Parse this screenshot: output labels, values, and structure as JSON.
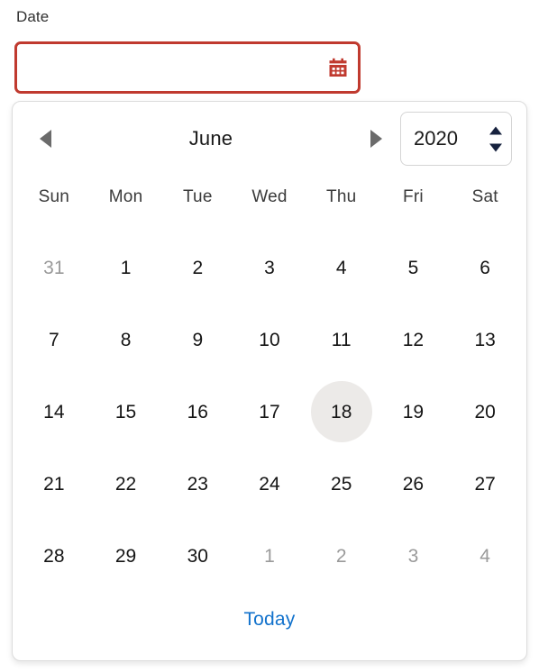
{
  "field": {
    "label": "Date",
    "value": "",
    "placeholder": "",
    "icon": "calendar-icon",
    "border_color": "#c03a2f"
  },
  "calendar": {
    "prev_icon": "triangle-left-icon",
    "next_icon": "triangle-right-icon",
    "month": "June",
    "year": "2020",
    "year_up_icon": "triangle-up-icon",
    "year_down_icon": "triangle-down-icon",
    "weekdays": [
      "Sun",
      "Mon",
      "Tue",
      "Wed",
      "Thu",
      "Fri",
      "Sat"
    ],
    "days": [
      {
        "label": "31",
        "muted": true,
        "today": false
      },
      {
        "label": "1",
        "muted": false,
        "today": false
      },
      {
        "label": "2",
        "muted": false,
        "today": false
      },
      {
        "label": "3",
        "muted": false,
        "today": false
      },
      {
        "label": "4",
        "muted": false,
        "today": false
      },
      {
        "label": "5",
        "muted": false,
        "today": false
      },
      {
        "label": "6",
        "muted": false,
        "today": false
      },
      {
        "label": "7",
        "muted": false,
        "today": false
      },
      {
        "label": "8",
        "muted": false,
        "today": false
      },
      {
        "label": "9",
        "muted": false,
        "today": false
      },
      {
        "label": "10",
        "muted": false,
        "today": false
      },
      {
        "label": "11",
        "muted": false,
        "today": false
      },
      {
        "label": "12",
        "muted": false,
        "today": false
      },
      {
        "label": "13",
        "muted": false,
        "today": false
      },
      {
        "label": "14",
        "muted": false,
        "today": false
      },
      {
        "label": "15",
        "muted": false,
        "today": false
      },
      {
        "label": "16",
        "muted": false,
        "today": false
      },
      {
        "label": "17",
        "muted": false,
        "today": false
      },
      {
        "label": "18",
        "muted": false,
        "today": true
      },
      {
        "label": "19",
        "muted": false,
        "today": false
      },
      {
        "label": "20",
        "muted": false,
        "today": false
      },
      {
        "label": "21",
        "muted": false,
        "today": false
      },
      {
        "label": "22",
        "muted": false,
        "today": false
      },
      {
        "label": "23",
        "muted": false,
        "today": false
      },
      {
        "label": "24",
        "muted": false,
        "today": false
      },
      {
        "label": "25",
        "muted": false,
        "today": false
      },
      {
        "label": "26",
        "muted": false,
        "today": false
      },
      {
        "label": "27",
        "muted": false,
        "today": false
      },
      {
        "label": "28",
        "muted": false,
        "today": false
      },
      {
        "label": "29",
        "muted": false,
        "today": false
      },
      {
        "label": "30",
        "muted": false,
        "today": false
      },
      {
        "label": "1",
        "muted": true,
        "today": false
      },
      {
        "label": "2",
        "muted": true,
        "today": false
      },
      {
        "label": "3",
        "muted": true,
        "today": false
      },
      {
        "label": "4",
        "muted": true,
        "today": false
      }
    ],
    "today_label": "Today",
    "today_link_color": "#1272cc",
    "today_highlight_color": "#eceae8"
  }
}
